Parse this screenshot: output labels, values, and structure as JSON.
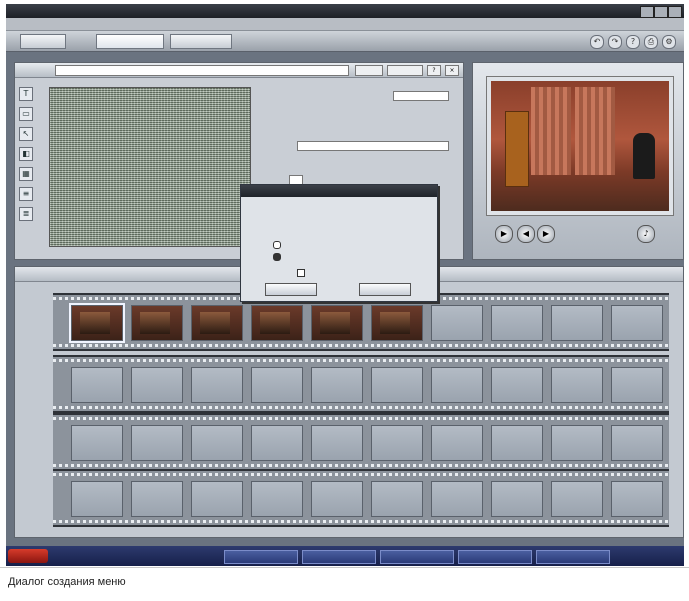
{
  "caption": "Диалог создания меню"
}
